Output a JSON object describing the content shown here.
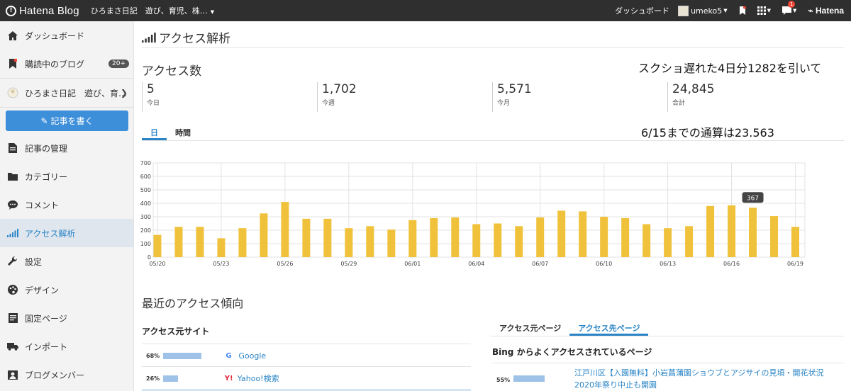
{
  "topbar": {
    "logo_text": "Hatena Blog",
    "blog_name": "ひろまさ日記　遊び、育児、株…",
    "dashboard_label": "ダッシュボード",
    "username": "umeko5",
    "notification_count": "1",
    "brand": "Hatena"
  },
  "sidebar": {
    "items": [
      {
        "label": "ダッシュボード",
        "icon": "home-icon"
      },
      {
        "label": "購読中のブログ",
        "icon": "bookmark-icon",
        "count": "20+"
      },
      {
        "label": "ひろまさ日記　遊び、育…",
        "icon": "blog-avatar"
      },
      {
        "label": "記事の管理",
        "icon": "document-icon"
      },
      {
        "label": "カテゴリー",
        "icon": "folder-icon"
      },
      {
        "label": "コメント",
        "icon": "comment-icon"
      },
      {
        "label": "アクセス解析",
        "icon": "signal-icon"
      },
      {
        "label": "設定",
        "icon": "wrench-icon"
      },
      {
        "label": "デザイン",
        "icon": "palette-icon"
      },
      {
        "label": "固定ページ",
        "icon": "page-icon"
      },
      {
        "label": "インポート",
        "icon": "truck-icon"
      },
      {
        "label": "ブログメンバー",
        "icon": "member-icon"
      }
    ],
    "write_button": "記事を書く"
  },
  "main": {
    "title": "アクセス解析",
    "access_count_title": "アクセス数",
    "note1": "スクショ遅れた4日分1282を引いて",
    "note2": "6/15までの通算は23.563",
    "stats": [
      {
        "value": "5",
        "label": "今日"
      },
      {
        "value": "1,702",
        "label": "今週"
      },
      {
        "value": "5,571",
        "label": "今月"
      },
      {
        "value": "24,845",
        "label": "合計"
      }
    ],
    "tabs": [
      "日",
      "時間"
    ],
    "trend_title": "最近のアクセス傾向",
    "referrer_title": "アクセス元サイト",
    "referrers": [
      {
        "pct": "68%",
        "name": "Google",
        "value": 68
      },
      {
        "pct": "26%",
        "name": "Yahoo!検索",
        "value": 26
      }
    ],
    "tabs2": [
      "アクセス元ページ",
      "アクセス先ページ"
    ],
    "bing_title": "Bing からよくアクセスされているページ",
    "bing_rows": [
      {
        "pct": "55%",
        "value": 55,
        "title": "江戸川区【入園無料】小岩菖蒲園ショウブとアジサイの見頃・開花状況2020年祭り中止も開園"
      }
    ]
  },
  "chart_data": {
    "type": "bar",
    "color": "#f0c23b",
    "categories": [
      "05/20",
      "05/21",
      "05/22",
      "05/23",
      "05/24",
      "05/25",
      "05/26",
      "05/27",
      "05/28",
      "05/29",
      "05/30",
      "05/31",
      "06/01",
      "06/02",
      "06/03",
      "06/04",
      "06/05",
      "06/06",
      "06/07",
      "06/08",
      "06/09",
      "06/10",
      "06/11",
      "06/12",
      "06/13",
      "06/14",
      "06/15",
      "06/16",
      "06/17",
      "06/18",
      "06/19"
    ],
    "values": [
      165,
      225,
      225,
      140,
      215,
      325,
      410,
      285,
      285,
      215,
      230,
      205,
      275,
      290,
      295,
      245,
      250,
      230,
      295,
      345,
      340,
      300,
      290,
      245,
      215,
      230,
      380,
      385,
      367,
      305,
      225
    ],
    "ylim": [
      0,
      700
    ],
    "yticks": [
      "0",
      "100",
      "200",
      "300",
      "400",
      "500",
      "600",
      "700"
    ],
    "xtick_labels": [
      "05/20",
      "05/23",
      "05/26",
      "05/29",
      "06/01",
      "06/04",
      "06/07",
      "06/10",
      "06/13",
      "06/16",
      "06/19"
    ],
    "tooltip": {
      "category": "06/17",
      "label": "367"
    }
  }
}
